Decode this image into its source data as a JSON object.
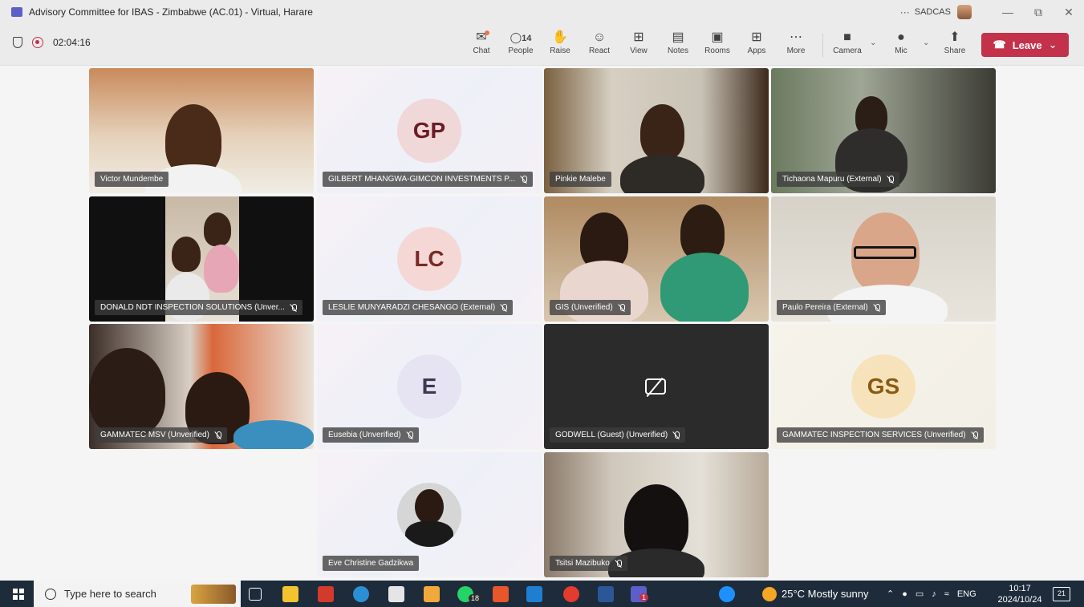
{
  "window": {
    "title": "Advisory Committee for IBAS - Zimbabwe (AC.01) - Virtual, Harare",
    "more": "···",
    "org": "SADCAS",
    "minimize": "—",
    "restore": "⧉",
    "close": "✕"
  },
  "meeting": {
    "elapsed": "02:04:16"
  },
  "toolbar": {
    "chat": "Chat",
    "people_count": "14",
    "people": "People",
    "raise": "Raise",
    "react": "React",
    "view": "View",
    "notes": "Notes",
    "rooms": "Rooms",
    "apps": "Apps",
    "more": "More",
    "camera": "Camera",
    "mic": "Mic",
    "share": "Share",
    "leave": "Leave"
  },
  "participants": [
    {
      "name": "Victor Mundembe"
    },
    {
      "name": "GILBERT MHANGWA-GIMCON INVESTMENTS P...",
      "initials": "GP"
    },
    {
      "name": "Pinkie Malebe"
    },
    {
      "name": "Tichaona Mapuru (External)"
    },
    {
      "name": "DONALD NDT INSPECTION SOLUTIONS (Unver..."
    },
    {
      "name": "LESLIE MUNYARADZI CHESANGO (External)",
      "initials": "LC"
    },
    {
      "name": "GIS (Unverified)"
    },
    {
      "name": "Paulo Pereira (External)"
    },
    {
      "name": "GAMMATEC MSV (Unverified)"
    },
    {
      "name": "Eusebia (Unverified)",
      "initials": "E"
    },
    {
      "name": "GODWELL (Guest) (Unverified)"
    },
    {
      "name": "GAMMATEC INSPECTION SERVICES (Unverified)",
      "initials": "GS"
    },
    {
      "name": "Eve Christine Gadzikwa"
    },
    {
      "name": "Tsitsi Mazibuko"
    }
  ],
  "taskbar": {
    "search_placeholder": "Type here to search",
    "whatsapp_badge": "18",
    "teams_badge": "1",
    "weather": "25°C  Mostly sunny",
    "lang": "ENG",
    "time": "10:17",
    "date": "2024/10/24",
    "notifications": "21"
  }
}
